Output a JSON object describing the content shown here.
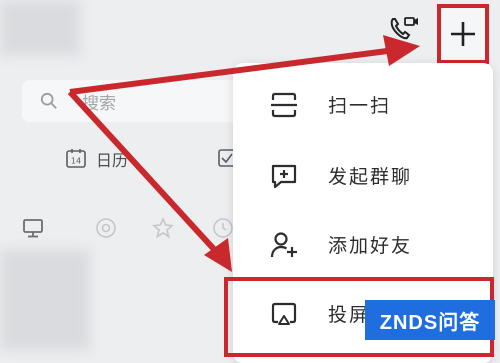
{
  "search": {
    "placeholder": "搜索"
  },
  "quick_actions": {
    "calendar_label": "日历",
    "calendar_day": "14"
  },
  "menu": {
    "items": [
      {
        "label": "扫一扫",
        "icon": "scan-icon"
      },
      {
        "label": "发起群聊",
        "icon": "group-chat-icon"
      },
      {
        "label": "添加好友",
        "icon": "add-friend-icon"
      },
      {
        "label": "投屏",
        "icon": "screen-cast-icon"
      }
    ]
  },
  "watermark": {
    "text": "ZNDS问答"
  },
  "colors": {
    "highlight": "#c9282d",
    "watermark_bg": "#1f6ee0",
    "menu_bg": "#ffffff"
  }
}
